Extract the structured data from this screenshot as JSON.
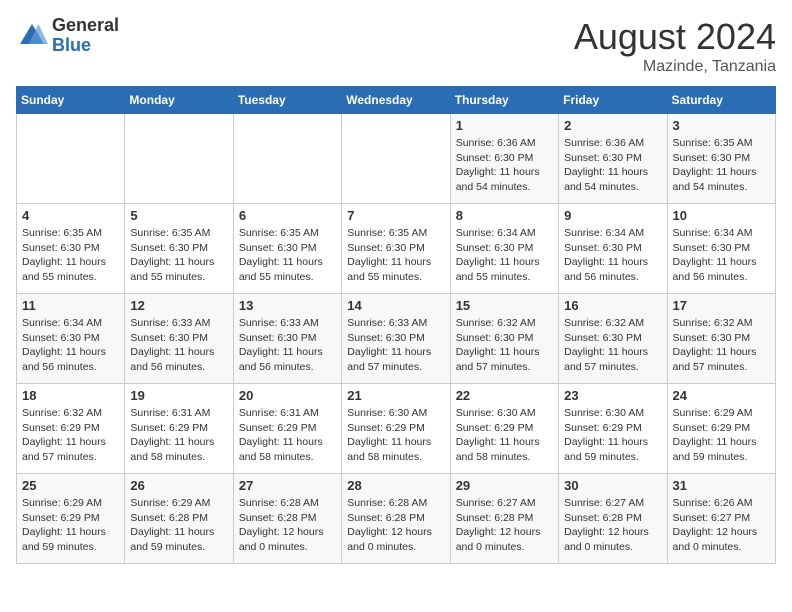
{
  "logo": {
    "general": "General",
    "blue": "Blue"
  },
  "header": {
    "month_year": "August 2024",
    "location": "Mazinde, Tanzania"
  },
  "days_of_week": [
    "Sunday",
    "Monday",
    "Tuesday",
    "Wednesday",
    "Thursday",
    "Friday",
    "Saturday"
  ],
  "weeks": [
    [
      {
        "day": "",
        "info": ""
      },
      {
        "day": "",
        "info": ""
      },
      {
        "day": "",
        "info": ""
      },
      {
        "day": "",
        "info": ""
      },
      {
        "day": "1",
        "info": "Sunrise: 6:36 AM\nSunset: 6:30 PM\nDaylight: 11 hours and 54 minutes."
      },
      {
        "day": "2",
        "info": "Sunrise: 6:36 AM\nSunset: 6:30 PM\nDaylight: 11 hours and 54 minutes."
      },
      {
        "day": "3",
        "info": "Sunrise: 6:35 AM\nSunset: 6:30 PM\nDaylight: 11 hours and 54 minutes."
      }
    ],
    [
      {
        "day": "4",
        "info": "Sunrise: 6:35 AM\nSunset: 6:30 PM\nDaylight: 11 hours and 55 minutes."
      },
      {
        "day": "5",
        "info": "Sunrise: 6:35 AM\nSunset: 6:30 PM\nDaylight: 11 hours and 55 minutes."
      },
      {
        "day": "6",
        "info": "Sunrise: 6:35 AM\nSunset: 6:30 PM\nDaylight: 11 hours and 55 minutes."
      },
      {
        "day": "7",
        "info": "Sunrise: 6:35 AM\nSunset: 6:30 PM\nDaylight: 11 hours and 55 minutes."
      },
      {
        "day": "8",
        "info": "Sunrise: 6:34 AM\nSunset: 6:30 PM\nDaylight: 11 hours and 55 minutes."
      },
      {
        "day": "9",
        "info": "Sunrise: 6:34 AM\nSunset: 6:30 PM\nDaylight: 11 hours and 56 minutes."
      },
      {
        "day": "10",
        "info": "Sunrise: 6:34 AM\nSunset: 6:30 PM\nDaylight: 11 hours and 56 minutes."
      }
    ],
    [
      {
        "day": "11",
        "info": "Sunrise: 6:34 AM\nSunset: 6:30 PM\nDaylight: 11 hours and 56 minutes."
      },
      {
        "day": "12",
        "info": "Sunrise: 6:33 AM\nSunset: 6:30 PM\nDaylight: 11 hours and 56 minutes."
      },
      {
        "day": "13",
        "info": "Sunrise: 6:33 AM\nSunset: 6:30 PM\nDaylight: 11 hours and 56 minutes."
      },
      {
        "day": "14",
        "info": "Sunrise: 6:33 AM\nSunset: 6:30 PM\nDaylight: 11 hours and 57 minutes."
      },
      {
        "day": "15",
        "info": "Sunrise: 6:32 AM\nSunset: 6:30 PM\nDaylight: 11 hours and 57 minutes."
      },
      {
        "day": "16",
        "info": "Sunrise: 6:32 AM\nSunset: 6:30 PM\nDaylight: 11 hours and 57 minutes."
      },
      {
        "day": "17",
        "info": "Sunrise: 6:32 AM\nSunset: 6:30 PM\nDaylight: 11 hours and 57 minutes."
      }
    ],
    [
      {
        "day": "18",
        "info": "Sunrise: 6:32 AM\nSunset: 6:29 PM\nDaylight: 11 hours and 57 minutes."
      },
      {
        "day": "19",
        "info": "Sunrise: 6:31 AM\nSunset: 6:29 PM\nDaylight: 11 hours and 58 minutes."
      },
      {
        "day": "20",
        "info": "Sunrise: 6:31 AM\nSunset: 6:29 PM\nDaylight: 11 hours and 58 minutes."
      },
      {
        "day": "21",
        "info": "Sunrise: 6:30 AM\nSunset: 6:29 PM\nDaylight: 11 hours and 58 minutes."
      },
      {
        "day": "22",
        "info": "Sunrise: 6:30 AM\nSunset: 6:29 PM\nDaylight: 11 hours and 58 minutes."
      },
      {
        "day": "23",
        "info": "Sunrise: 6:30 AM\nSunset: 6:29 PM\nDaylight: 11 hours and 59 minutes."
      },
      {
        "day": "24",
        "info": "Sunrise: 6:29 AM\nSunset: 6:29 PM\nDaylight: 11 hours and 59 minutes."
      }
    ],
    [
      {
        "day": "25",
        "info": "Sunrise: 6:29 AM\nSunset: 6:29 PM\nDaylight: 11 hours and 59 minutes."
      },
      {
        "day": "26",
        "info": "Sunrise: 6:29 AM\nSunset: 6:28 PM\nDaylight: 11 hours and 59 minutes."
      },
      {
        "day": "27",
        "info": "Sunrise: 6:28 AM\nSunset: 6:28 PM\nDaylight: 12 hours and 0 minutes."
      },
      {
        "day": "28",
        "info": "Sunrise: 6:28 AM\nSunset: 6:28 PM\nDaylight: 12 hours and 0 minutes."
      },
      {
        "day": "29",
        "info": "Sunrise: 6:27 AM\nSunset: 6:28 PM\nDaylight: 12 hours and 0 minutes."
      },
      {
        "day": "30",
        "info": "Sunrise: 6:27 AM\nSunset: 6:28 PM\nDaylight: 12 hours and 0 minutes."
      },
      {
        "day": "31",
        "info": "Sunrise: 6:26 AM\nSunset: 6:27 PM\nDaylight: 12 hours and 0 minutes."
      }
    ]
  ]
}
